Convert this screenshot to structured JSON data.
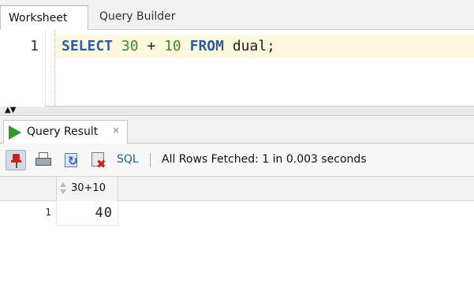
{
  "worksheet_tabs": [
    {
      "label": "Worksheet",
      "active": true
    },
    {
      "label": "Query Builder",
      "active": false
    }
  ],
  "editor": {
    "line_number": "1",
    "tokens": {
      "select": "SELECT",
      "num1": "30",
      "plus": "+",
      "num2": "10",
      "from": "FROM",
      "table": "dual;"
    },
    "keyword_color": "#2f5d9a",
    "number_color": "#3a8a2a"
  },
  "results": {
    "tab_label": "Query Result",
    "tab_close": "×",
    "toolbar": {
      "icons": [
        "pin-icon",
        "print-icon",
        "refresh-icon",
        "cancel-query-icon"
      ],
      "sql_label": "SQL",
      "status": "All Rows Fetched: 1 in 0.003 seconds"
    },
    "grid": {
      "columns": [
        "30+10"
      ],
      "rows": [
        {
          "row_number": "1",
          "cells": [
            "40"
          ]
        }
      ]
    }
  }
}
